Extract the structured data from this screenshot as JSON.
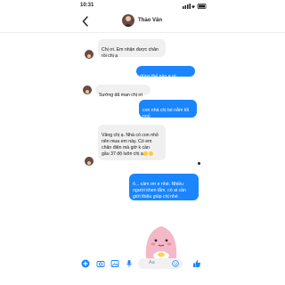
{
  "status_bar": {
    "time": "10:31"
  },
  "header": {
    "contact_name": "Thảo Vân"
  },
  "messages": [
    {
      "side": "in",
      "text": "Chị ơi. Em nhận được chăn\nrồi chị ạ"
    },
    {
      "side": "out",
      "text": "dùng thế nào e ơi"
    },
    {
      "side": "in",
      "text": "Sướng dã man chị ơi"
    },
    {
      "side": "out",
      "text": "con nhà chị bé nằm tối ngủ\nthin thít ấy"
    },
    {
      "side": "in",
      "text": "Vâng chị ạ. Nhà có con nhỏ\nnên mua em này. Có em\nchăn điện mà giờ k cần\ngầu 37 độ luôn chị ạ"
    },
    {
      "side": "out",
      "text": "ô... cảm ơn e nhé. Nhiều\nngười khen lắm. có ai cần\ngiới thiệu giúp chị nhé"
    }
  ],
  "composer": {
    "placeholder": "Aa"
  },
  "colors": {
    "brand_blue": "#1a85ff",
    "incoming_bg": "#f0f0f0"
  },
  "icons": [
    "back-arrow-icon",
    "plus-icon",
    "camera-icon",
    "image-icon",
    "mic-icon",
    "emoji-icon",
    "like-icon"
  ]
}
